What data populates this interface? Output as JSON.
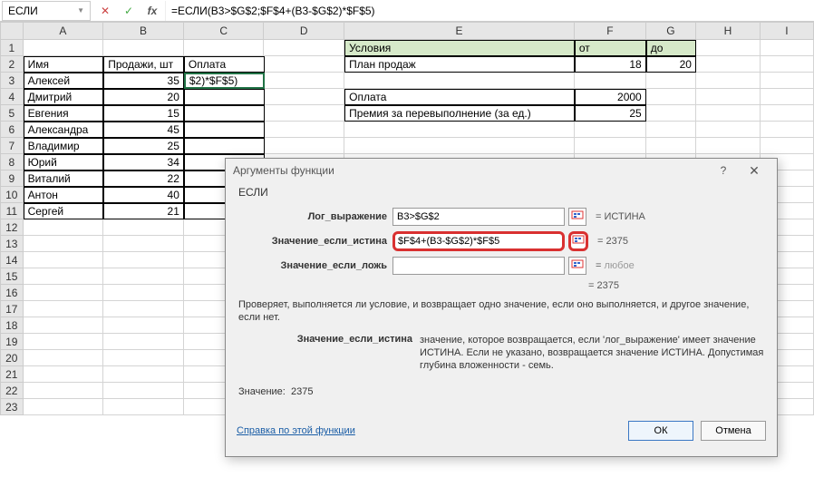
{
  "formulaBar": {
    "nameBox": "ЕСЛИ",
    "formula": "=ЕСЛИ(B3>$G$2;$F$4+(B3-$G$2)*$F$5)"
  },
  "columns": [
    "A",
    "B",
    "C",
    "D",
    "E",
    "F",
    "G",
    "H",
    "I"
  ],
  "rowNumbers": [
    1,
    2,
    3,
    4,
    5,
    6,
    7,
    8,
    9,
    10,
    11,
    12,
    13,
    14,
    15,
    16,
    17,
    18,
    19,
    20,
    21,
    22,
    23
  ],
  "table1": {
    "headers": {
      "A": "Имя",
      "B": "Продажи, шт",
      "C": "Оплата"
    },
    "rows": [
      {
        "A": "Алексей",
        "B": "35",
        "C": "$2)*$F$5)"
      },
      {
        "A": "Дмитрий",
        "B": "20",
        "C": ""
      },
      {
        "A": "Евгения",
        "B": "15",
        "C": ""
      },
      {
        "A": "Александра",
        "B": "45",
        "C": ""
      },
      {
        "A": "Владимир",
        "B": "25",
        "C": ""
      },
      {
        "A": "Юрий",
        "B": "34",
        "C": ""
      },
      {
        "A": "Виталий",
        "B": "22",
        "C": ""
      },
      {
        "A": "Антон",
        "B": "40",
        "C": ""
      },
      {
        "A": "Сергей",
        "B": "21",
        "C": ""
      }
    ]
  },
  "table2": {
    "headers": {
      "E": "Условия",
      "F": "от",
      "G": "до"
    },
    "rows": [
      {
        "E": "План продаж",
        "F": "18",
        "G": "20"
      },
      {
        "E": "",
        "F": "",
        "G": ""
      },
      {
        "E": "Оплата",
        "F": "2000",
        "G": ""
      },
      {
        "E": "Премия за перевыполнение (за ед.)",
        "F": "25",
        "G": ""
      }
    ]
  },
  "dialog": {
    "title": "Аргументы функции",
    "fnName": "ЕСЛИ",
    "args": [
      {
        "label": "Лог_выражение",
        "value": "B3>$G$2",
        "result": "ИСТИНА",
        "highlight": false
      },
      {
        "label": "Значение_если_истина",
        "value": "$F$4+(B3-$G$2)*$F$5",
        "result": "2375",
        "highlight": true
      },
      {
        "label": "Значение_если_ложь",
        "value": "",
        "result": "любое",
        "gray": true
      }
    ],
    "formulaResult": "2375",
    "description": "Проверяет, выполняется ли условие, и возвращает одно значение, если оно выполняется, и другое значение, если нет.",
    "argHelp": {
      "label": "Значение_если_истина",
      "text": "значение, которое возвращается, если 'лог_выражение' имеет значение ИСТИНА. Если не указано, возвращается значение ИСТИНА. Допустимая глубина вложенности - семь."
    },
    "resultLabel": "Значение:",
    "resultValue": "2375",
    "helpLink": "Справка по этой функции",
    "ok": "ОК",
    "cancel": "Отмена"
  }
}
